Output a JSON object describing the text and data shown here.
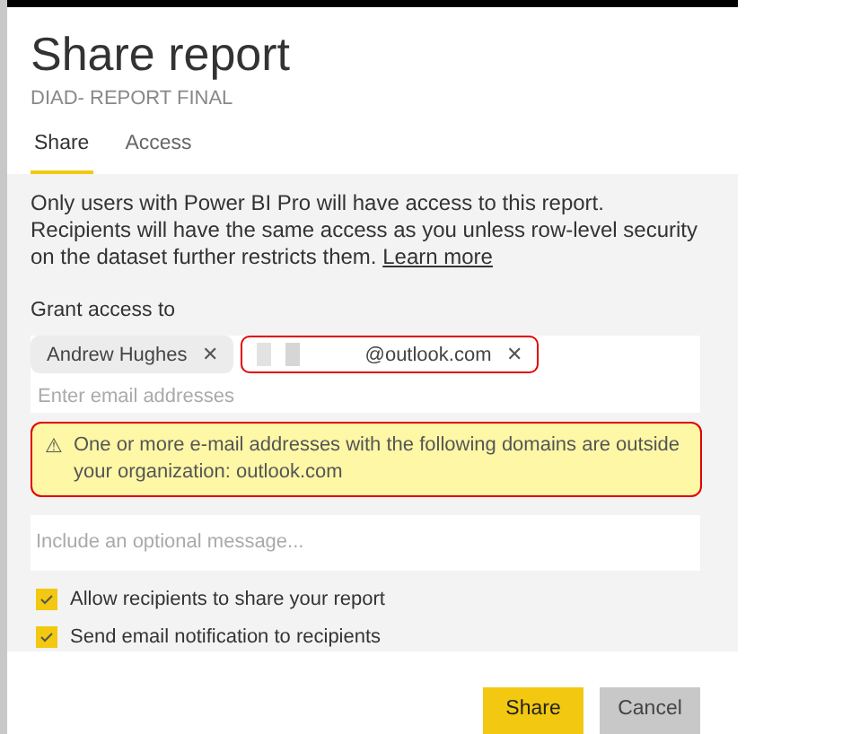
{
  "dialog": {
    "title": "Share report",
    "subtitle": "DIAD- REPORT FINAL"
  },
  "tabs": [
    {
      "label": "Share",
      "selected": true
    },
    {
      "label": "Access",
      "selected": false
    }
  ],
  "notice": {
    "text": "Only users with Power BI Pro will have access to this report. Recipients will have the same access as you unless row-level security on the dataset further restricts them.",
    "link": "Learn more"
  },
  "grant_access": {
    "label": "Grant access to",
    "recipients": [
      {
        "name": "Andrew Hughes",
        "highlighted": false,
        "redacted": false,
        "remove": "✕"
      },
      {
        "name": "@outlook.com",
        "highlighted": true,
        "redacted": true,
        "remove": "✕"
      }
    ],
    "placeholder": "Enter email addresses"
  },
  "warning": {
    "icon": "⚠",
    "text": "One or more e-mail addresses with the following domains are outside your organization: outlook.com",
    "highlighted": true
  },
  "message": {
    "placeholder": "Include an optional message..."
  },
  "options": [
    {
      "label": "Allow recipients to share your report",
      "checked": true
    },
    {
      "label": "Send email notification to recipients",
      "checked": true
    }
  ],
  "buttons": [
    {
      "label": "Share",
      "kind": "primary"
    },
    {
      "label": "Cancel",
      "kind": "secondary"
    }
  ]
}
